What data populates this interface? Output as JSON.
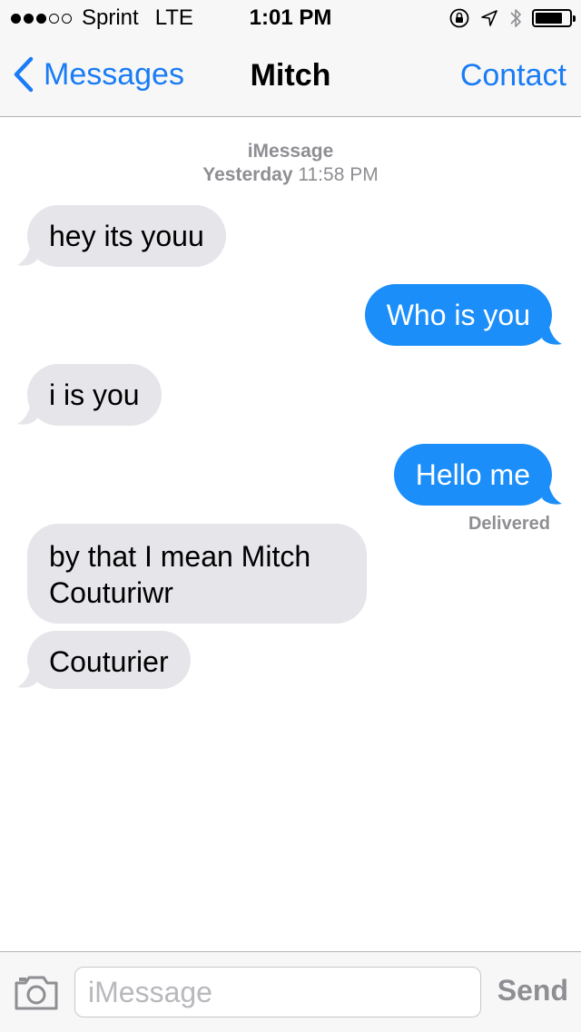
{
  "status_bar": {
    "signal": "●●●○○",
    "carrier": "Sprint",
    "network": "LTE",
    "time": "1:01 PM",
    "icons": [
      "orientation-lock-icon",
      "location-arrow-icon",
      "bluetooth-icon",
      "battery-icon"
    ],
    "battery_level": 0.8
  },
  "nav": {
    "back_label": "Messages",
    "title": "Mitch",
    "contact_label": "Contact"
  },
  "conversation": {
    "service": "iMessage",
    "day": "Yesterday",
    "time": "11:58 PM",
    "messages": [
      {
        "side": "incoming",
        "text": "hey its youu"
      },
      {
        "side": "outgoing",
        "text": "Who is you"
      },
      {
        "side": "incoming",
        "text": "i is you"
      },
      {
        "side": "outgoing",
        "text": "Hello me"
      },
      {
        "side": "incoming",
        "text": "by that I mean Mitch Couturiwr"
      },
      {
        "side": "incoming",
        "text": "Couturier"
      }
    ],
    "delivered_label": "Delivered"
  },
  "composer": {
    "value": "",
    "placeholder": "iMessage",
    "send_label": "Send"
  },
  "colors": {
    "accent": "#1a7cf5",
    "outgoing_bubble": "#1b8ef9",
    "incoming_bubble": "#e5e5ea",
    "secondary_text": "#8e8e93"
  }
}
